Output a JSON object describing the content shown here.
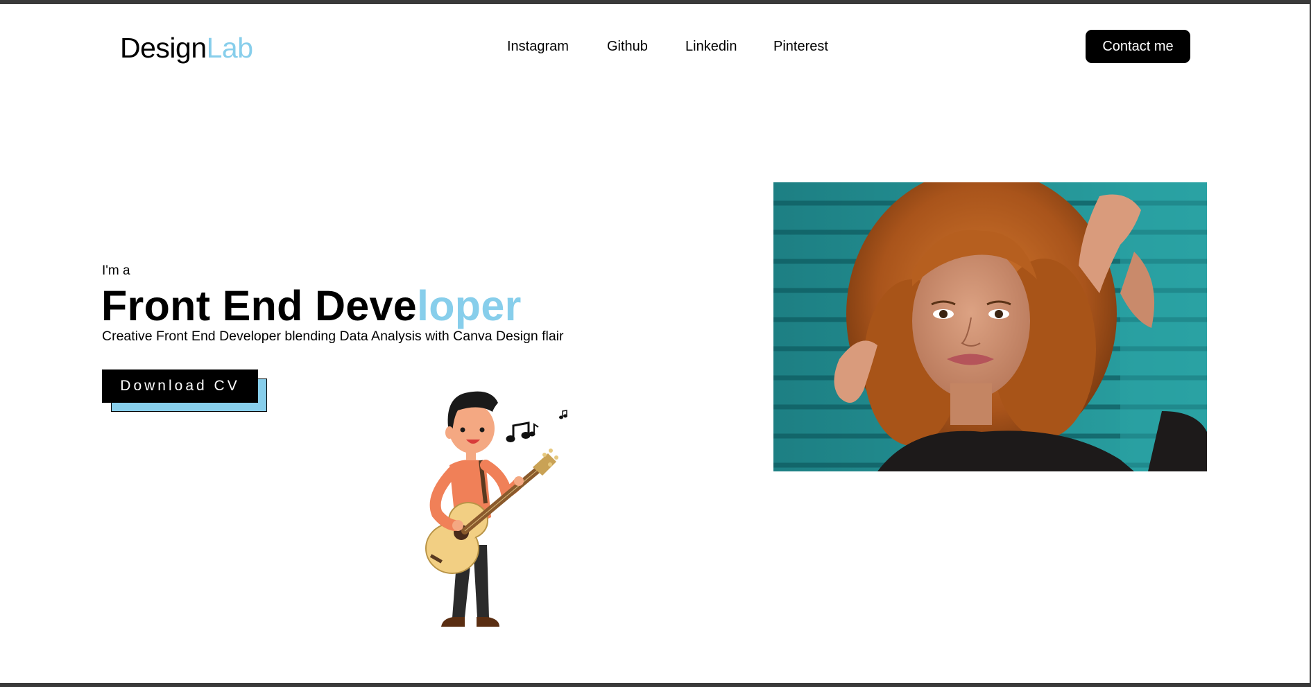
{
  "header": {
    "logo_primary": "Design",
    "logo_accent": "Lab",
    "nav": [
      "Instagram",
      "Github",
      "Linkedin",
      "Pinterest"
    ],
    "contact_label": "Contact me"
  },
  "hero": {
    "intro": "I'm a",
    "headline_main": "Front End Deve",
    "headline_accent": "loper",
    "tagline": "Creative Front End Developer blending Data Analysis with Canva Design flair",
    "cv_label": "Download CV"
  },
  "colors": {
    "accent": "#87ceeb",
    "primary": "#000000",
    "background": "#ffffff",
    "photo_backdrop": "#1e8a8c",
    "hair": "#b5621f",
    "shirt": "#f08058"
  },
  "icons": {
    "illustration": "guitar-player-illustration",
    "music_notes": "music-notes-icon",
    "portrait": "woman-curly-hair-portrait"
  }
}
